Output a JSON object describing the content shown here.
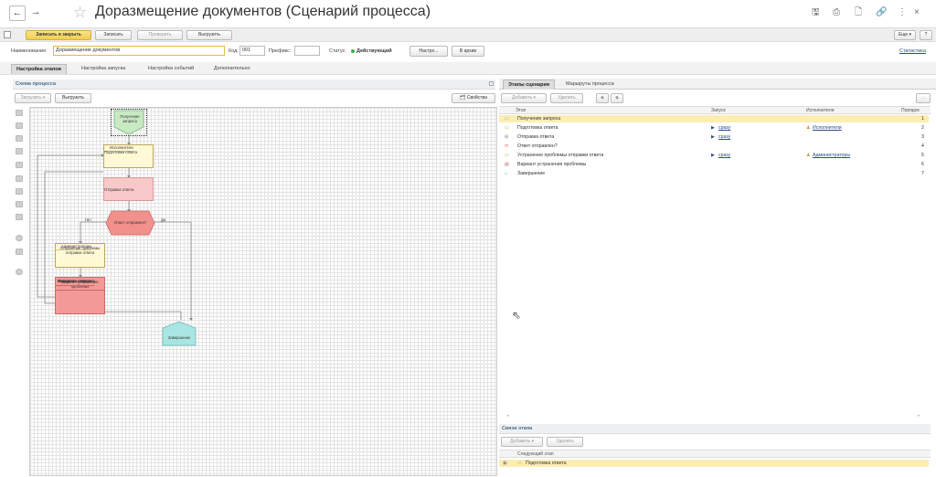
{
  "window": {
    "title": "Доразмещение документов (Сценарий процесса)",
    "more_label": "⋮",
    "close_label": "×"
  },
  "toolbar": {
    "save_close": "Записать и закрыть",
    "save": "Записать",
    "check": "Проверить",
    "export": "Выгрузить",
    "more": "Еще ▾",
    "help": "?"
  },
  "form": {
    "name_label": "Наименование:",
    "name_value": "Доразмещение документов",
    "code_label": "Код:",
    "code_value": "001",
    "prefix_label": "Префикс:",
    "prefix_value": "",
    "status_label": "Статус:",
    "status_value": "Действующий",
    "settings_button": "Настро...",
    "archive_button": "В архив",
    "stats_link": "Статистика"
  },
  "tabs": [
    {
      "label": "Настройка этапов"
    },
    {
      "label": "Настройка запуска"
    },
    {
      "label": "Настройка событий"
    },
    {
      "label": "Дополнительно"
    }
  ],
  "schema": {
    "title": "Схема процесса",
    "load_button": "Загрузить ▾",
    "unload_button": "Выгрузить",
    "props_button": "Свойства",
    "nodes": {
      "start": "Получение запроса",
      "prep_header": "Исполнители",
      "prep": "Подготовка ответа",
      "send": "Отправка ответа",
      "decision": "Ответ отправлен?",
      "no": "Нет",
      "yes": "Да",
      "fix_header": "Администраторы",
      "fix": "Устранение проблемы отправки ответа",
      "variant": "Вариант устранения проблемы",
      "opt1": "Отправить повторно",
      "opt2": "Исправить ответ",
      "opt3": "Прекратить отправку",
      "end": "Завершение"
    }
  },
  "right": {
    "tabs": [
      {
        "label": "Этапы сценария"
      },
      {
        "label": "Маршруты процесса"
      }
    ],
    "add_button": "Добавить ▾",
    "delete_button": "Удалить",
    "columns": {
      "stage": "Этап",
      "launch": "Запуск",
      "executors": "Исполнители",
      "order": "Порядок"
    },
    "rows": [
      {
        "stage": "Получение запроса",
        "launch": "",
        "executors": "",
        "order": "1"
      },
      {
        "stage": "Подготовка ответа",
        "launch": "сразу",
        "executors": "Исполнители",
        "order": "2"
      },
      {
        "stage": "Отправка ответа",
        "launch": "сразу",
        "executors": "",
        "order": "3"
      },
      {
        "stage": "Ответ отправлен?",
        "launch": "",
        "executors": "",
        "order": "4"
      },
      {
        "stage": "Устранение проблемы отправки ответа",
        "launch": "сразу",
        "executors": "Администраторы",
        "order": "5"
      },
      {
        "stage": "Вариант устранения проблемы",
        "launch": "",
        "executors": "",
        "order": "6"
      },
      {
        "stage": "Завершение",
        "launch": "",
        "executors": "",
        "order": "7"
      }
    ],
    "links": {
      "title": "Связи этапа",
      "add_button": "Добавить ▾",
      "delete_button": "Удалить",
      "column": "Следующий этап",
      "row": "Подготовка ответа"
    }
  },
  "colors": {
    "accent": "#f2cf4c",
    "selected_row": "#fbedb4",
    "status_green": "#3cb043",
    "link": "#2a4d8a"
  }
}
